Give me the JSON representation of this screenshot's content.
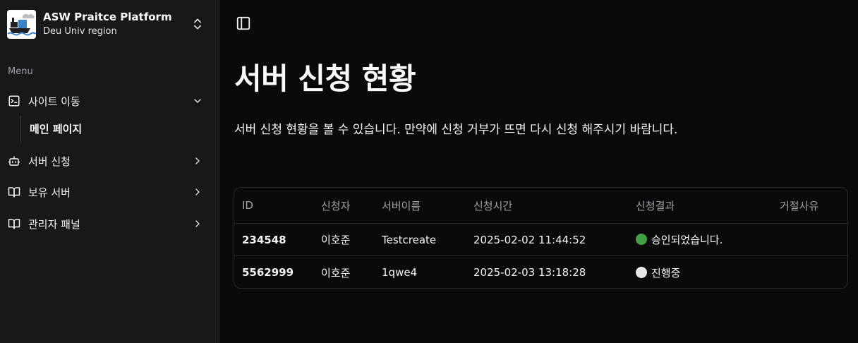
{
  "sidebar": {
    "brand_title": "ASW Praitce Platform",
    "brand_subtitle": "Deu Univ region",
    "menu_label": "Menu",
    "items": [
      {
        "label": "사이트 이동",
        "icon": "terminal-icon"
      },
      {
        "label": "서버 신청",
        "icon": "bot-icon"
      },
      {
        "label": "보유 서버",
        "icon": "book-open-icon"
      },
      {
        "label": "관리자 패널",
        "icon": "book-open-icon"
      }
    ],
    "sub_items": [
      {
        "label": "메인 페이지"
      }
    ]
  },
  "main": {
    "title": "서버 신청 현황",
    "description": "서버 신청 현황을 볼 수 있습니다. 만약에 신청 거부가 뜨면 다시 신청 해주시기 바람니다."
  },
  "table": {
    "headers": [
      "ID",
      "신청자",
      "서버이름",
      "신청시간",
      "신청결과",
      "거절사유"
    ],
    "rows": [
      {
        "id": "234548",
        "applicant": "이호준",
        "server": "Testcreate",
        "time": "2025-02-02 11:44:52",
        "status_dot": "green",
        "status": "승인되었습니다.",
        "reason": ""
      },
      {
        "id": "5562999",
        "applicant": "이호준",
        "server": "1qwe4",
        "time": "2025-02-03 13:18:28",
        "status_dot": "white",
        "status": "진행중",
        "reason": ""
      }
    ]
  },
  "colors": {
    "background": "#0a0a0b",
    "sidebar": "#18181b",
    "border": "#27272a",
    "status_green": "#43a047",
    "status_white": "#e6e6e6"
  }
}
